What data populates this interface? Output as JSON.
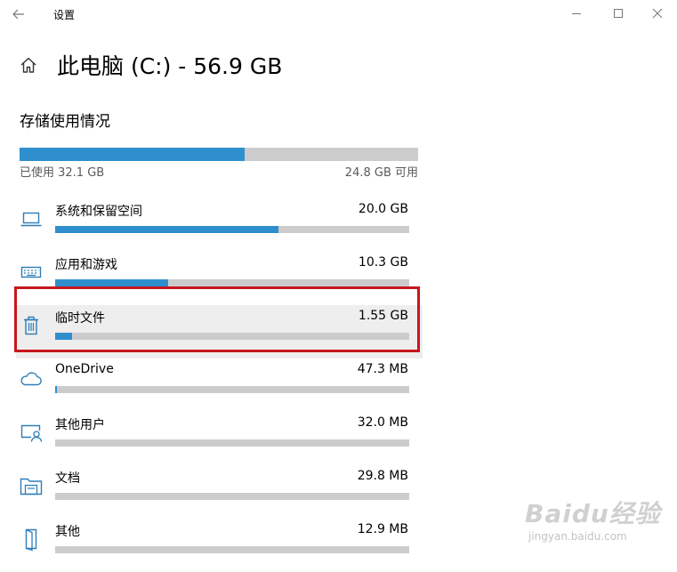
{
  "window": {
    "title": "设置"
  },
  "header": {
    "title": "此电脑 (C:) - 56.9 GB"
  },
  "storage": {
    "section_title": "存储使用情况",
    "used_label": "已使用 32.1 GB",
    "free_label": "24.8 GB 可用",
    "used_fraction": 0.564
  },
  "categories": [
    {
      "name": "系统和保留空间",
      "size": "20.0 GB",
      "icon": "laptop-icon",
      "fraction": 0.63
    },
    {
      "name": "应用和游戏",
      "size": "10.3 GB",
      "icon": "keyboard-icon",
      "fraction": 0.32
    },
    {
      "name": "临时文件",
      "size": "1.55 GB",
      "icon": "trash-icon",
      "fraction": 0.048
    },
    {
      "name": "OneDrive",
      "size": "47.3 MB",
      "icon": "cloud-icon",
      "fraction": 0.003
    },
    {
      "name": "其他用户",
      "size": "32.0 MB",
      "icon": "user-screen-icon",
      "fraction": 0.0
    },
    {
      "name": "文档",
      "size": "29.8 MB",
      "icon": "folder-icon",
      "fraction": 0.0
    },
    {
      "name": "其他",
      "size": "12.9 MB",
      "icon": "door-icon",
      "fraction": 0.0
    }
  ],
  "watermark": {
    "brand": "Baidu经验",
    "url": "jingyan.baidu.com"
  },
  "colors": {
    "accent": "#2f8fce",
    "track": "#cccccc",
    "highlight_border": "#c8161d"
  }
}
